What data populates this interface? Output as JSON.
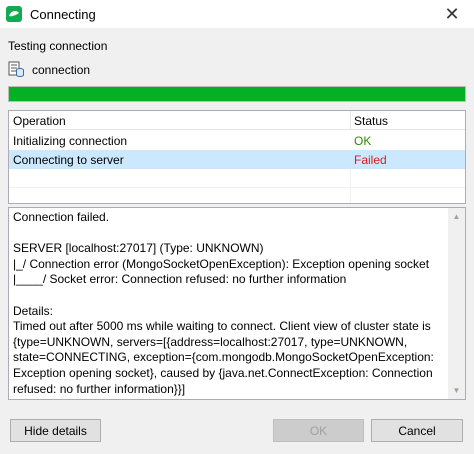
{
  "window": {
    "title": "Connecting",
    "close_label": "✕"
  },
  "header": {
    "section_label": "Testing connection",
    "connection_name": "connection"
  },
  "progress": {
    "fraction": 1.0,
    "color": "#06b025"
  },
  "operations": {
    "columns": [
      "Operation",
      "Status"
    ],
    "rows": [
      {
        "operation": "Initializing connection",
        "status": "OK",
        "status_color": "#2e8b00"
      },
      {
        "operation": "Connecting to server",
        "status": "Failed",
        "status_color": "#e01b1b",
        "selected": true
      }
    ]
  },
  "details": {
    "text": "Connection failed.\n\nSERVER [localhost:27017] (Type: UNKNOWN)\n|_/ Connection error (MongoSocketOpenException): Exception opening socket\n|____/ Socket error: Connection refused: no further information\n\nDetails:\nTimed out after 5000 ms while waiting to connect. Client view of cluster state is {type=UNKNOWN, servers=[{address=localhost:27017, type=UNKNOWN, state=CONNECTING, exception={com.mongodb.MongoSocketOpenException: Exception opening socket}, caused by {java.net.ConnectException: Connection refused: no further information}}]"
  },
  "buttons": {
    "hide_details": "Hide details",
    "ok": "OK",
    "cancel": "Cancel"
  },
  "icons": {
    "app": "mongodb-leaf-icon",
    "connection": "database-server-icon",
    "close": "close-icon",
    "scroll_up": "scroll-up-arrow-icon",
    "scroll_down": "scroll-down-arrow-icon"
  }
}
